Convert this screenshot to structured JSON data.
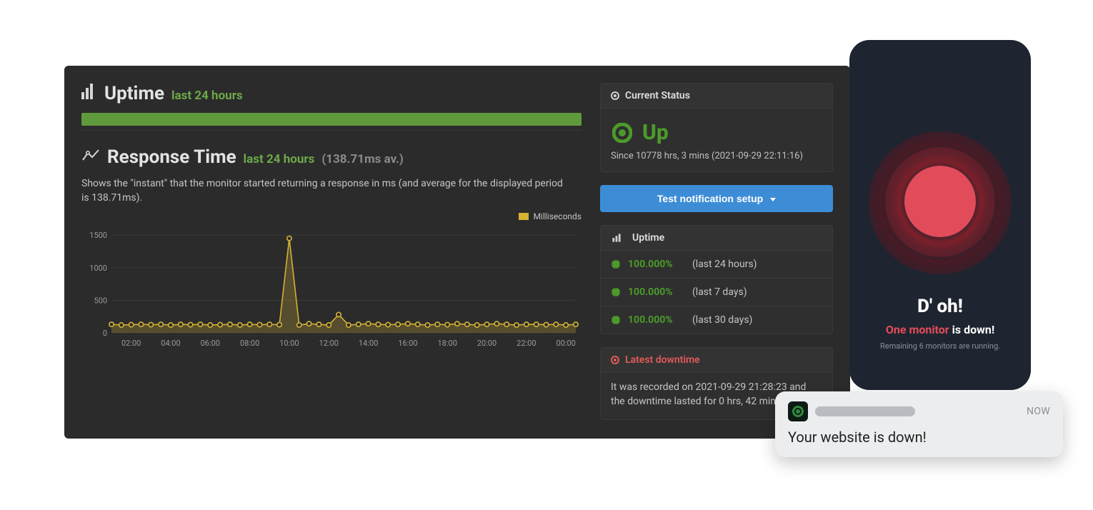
{
  "uptime_header": {
    "title": "Uptime",
    "subtitle": "last 24 hours"
  },
  "response_header": {
    "title": "Response Time",
    "subtitle": "last 24 hours",
    "avg_text": "(138.71ms av.)"
  },
  "response_desc": "Shows the \"instant\" that the monitor started returning a response in ms (and average for the displayed period is 138.71ms).",
  "legend_label": "Milliseconds",
  "status_panel": {
    "header": "Current Status",
    "state": "Up",
    "since": "Since 10778 hrs, 3 mins (2021-09-29 22:11:16)"
  },
  "test_button": "Test notification setup",
  "uptime_panel": {
    "header": "Uptime",
    "rows": [
      {
        "pct": "100.000%",
        "period": "(last 24 hours)"
      },
      {
        "pct": "100.000%",
        "period": "(last 7 days)"
      },
      {
        "pct": "100.000%",
        "period": "(last 30 days)"
      }
    ]
  },
  "downtime_panel": {
    "header": "Latest downtime",
    "text": "It was recorded on 2021-09-29 21:28:23 and the downtime lasted for 0 hrs, 42 mins."
  },
  "phone": {
    "title": "D' oh!",
    "accent": "One monitor",
    "rest": " is down!",
    "sub": "Remaining 6 monitors are running."
  },
  "toast": {
    "now": "NOW",
    "body": "Your website is down!"
  },
  "chart_data": {
    "type": "line",
    "title": "",
    "xlabel": "",
    "ylabel": "",
    "x_tick_labels": [
      "02:00",
      "04:00",
      "06:00",
      "08:00",
      "10:00",
      "12:00",
      "14:00",
      "16:00",
      "18:00",
      "20:00",
      "22:00",
      "00:00"
    ],
    "y_ticks": [
      0,
      500,
      1000,
      1500
    ],
    "ylim": [
      0,
      1600
    ],
    "series": [
      {
        "name": "Milliseconds",
        "x": [
          "01:00",
          "01:30",
          "02:00",
          "02:30",
          "03:00",
          "03:30",
          "04:00",
          "04:30",
          "05:00",
          "05:30",
          "06:00",
          "06:30",
          "07:00",
          "07:30",
          "08:00",
          "08:30",
          "09:00",
          "09:30",
          "10:00",
          "10:30",
          "11:00",
          "11:30",
          "12:00",
          "12:30",
          "13:00",
          "13:30",
          "14:00",
          "14:30",
          "15:00",
          "15:30",
          "16:00",
          "16:30",
          "17:00",
          "17:30",
          "18:00",
          "18:30",
          "19:00",
          "19:30",
          "20:00",
          "20:30",
          "21:00",
          "21:30",
          "22:00",
          "22:30",
          "23:00",
          "23:30",
          "00:00",
          "00:30"
        ],
        "values": [
          130,
          120,
          125,
          130,
          125,
          130,
          120,
          130,
          125,
          130,
          120,
          125,
          130,
          120,
          130,
          125,
          130,
          125,
          1450,
          120,
          140,
          130,
          120,
          280,
          120,
          130,
          140,
          130,
          125,
          130,
          140,
          130,
          120,
          130,
          125,
          140,
          130,
          120,
          130,
          140,
          130,
          120,
          130,
          130,
          125,
          130,
          120,
          130
        ]
      }
    ]
  }
}
